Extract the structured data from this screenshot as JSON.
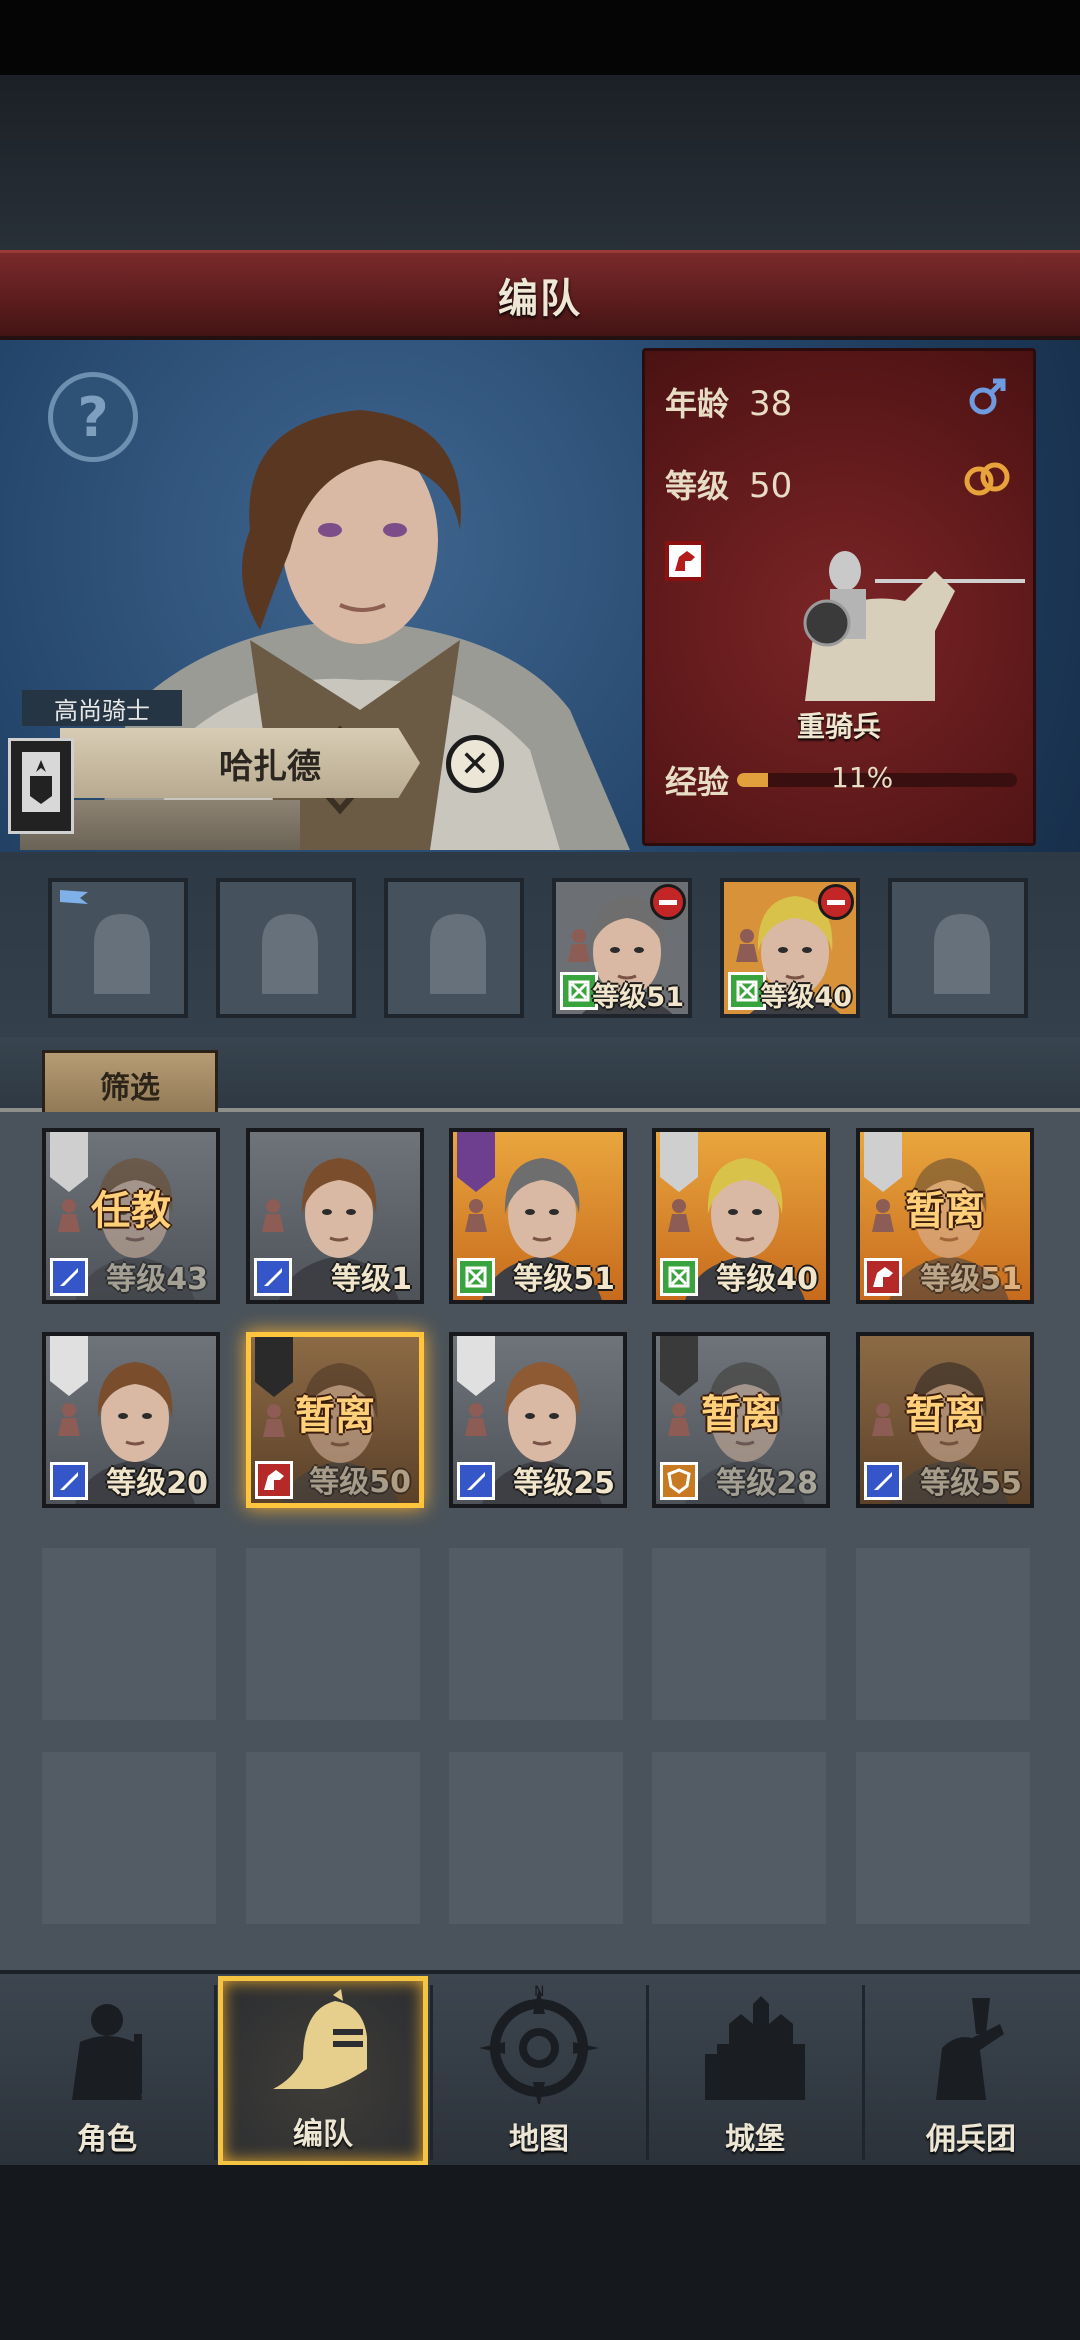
{
  "header": {
    "title": "编队"
  },
  "hero": {
    "class_title": "高尚骑士",
    "name": "哈扎德",
    "age_label": "年龄",
    "age": "38",
    "level_label": "等级",
    "level": "50",
    "unit_type": "重骑兵",
    "exp_label": "经验",
    "exp_percent": "11%",
    "exp_fraction": 0.11,
    "gender_icon": "male-icon",
    "trait_icon": "rings-icon"
  },
  "squad": {
    "slots": [
      {
        "state": "empty"
      },
      {
        "state": "empty"
      },
      {
        "state": "empty"
      },
      {
        "state": "filled",
        "level_text": "等级51",
        "role": "shield-cross"
      },
      {
        "state": "filled",
        "level_text": "等级40",
        "role": "shield-cross"
      },
      {
        "state": "empty"
      }
    ]
  },
  "filter": {
    "label": "筛选"
  },
  "roster": [
    {
      "level_text": "等级43",
      "status": "任教",
      "role": "sword",
      "bg": "gray"
    },
    {
      "level_text": "等级1",
      "status": "",
      "role": "sword",
      "bg": "gray"
    },
    {
      "level_text": "等级51",
      "status": "",
      "role": "shield-cross",
      "bg": "orange"
    },
    {
      "level_text": "等级40",
      "status": "",
      "role": "shield-cross",
      "bg": "orange"
    },
    {
      "level_text": "等级51",
      "status": "暂离",
      "role": "horse",
      "bg": "orange"
    },
    {
      "level_text": "等级20",
      "status": "",
      "role": "sword",
      "bg": "gray"
    },
    {
      "level_text": "等级50",
      "status": "暂离",
      "role": "horse",
      "bg": "brown",
      "selected": true
    },
    {
      "level_text": "等级25",
      "status": "",
      "role": "sword",
      "bg": "gray"
    },
    {
      "level_text": "等级28",
      "status": "暂离",
      "role": "shield",
      "bg": "gray"
    },
    {
      "level_text": "等级55",
      "status": "暂离",
      "role": "sword",
      "bg": "brown"
    }
  ],
  "nav": {
    "items": [
      {
        "label": "角色",
        "icon": "knight-icon"
      },
      {
        "label": "编队",
        "icon": "helmet-icon",
        "active": true
      },
      {
        "label": "地图",
        "icon": "compass-icon"
      },
      {
        "label": "城堡",
        "icon": "castle-icon"
      },
      {
        "label": "佣兵团",
        "icon": "mercenary-icon"
      }
    ]
  },
  "colors": {
    "banner_red": "#6b2122",
    "panel_blue": "#24456a",
    "highlight_gold": "#f5c443",
    "card_orange": "#e9a63d"
  }
}
